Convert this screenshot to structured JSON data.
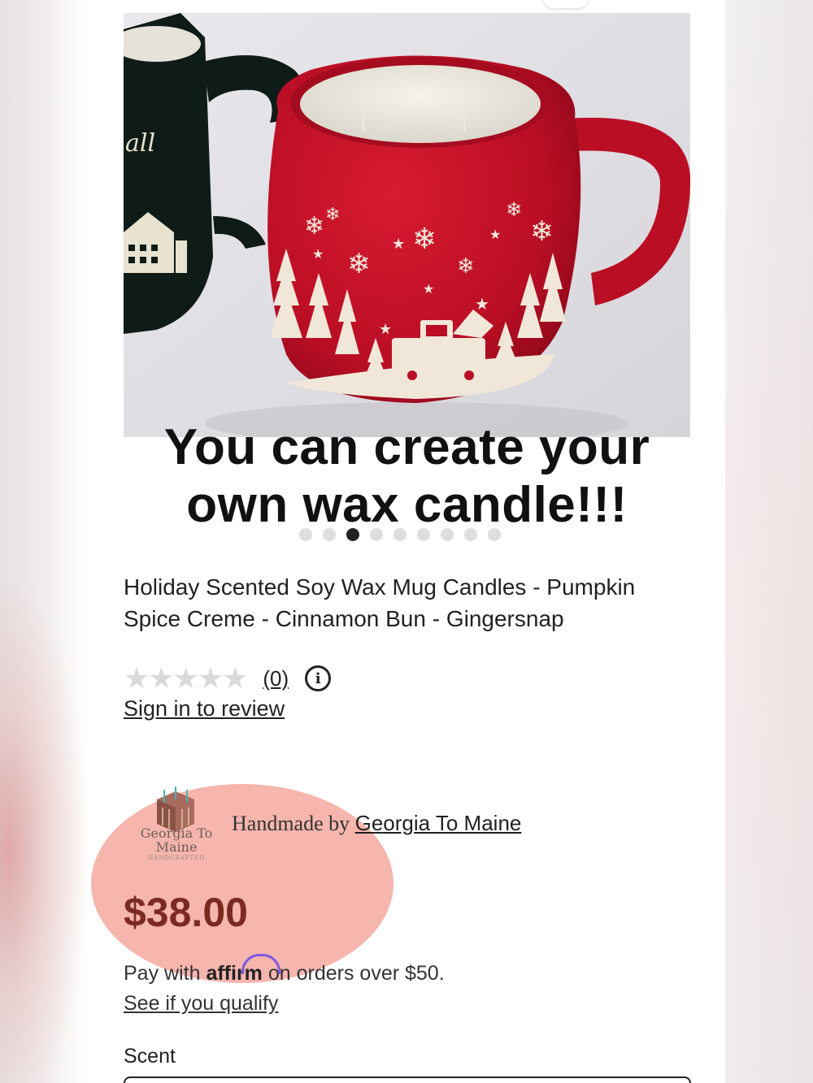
{
  "product": {
    "image_alt": "Red holiday mug candle with white snowflakes, trees and a truck; green mug candle behind it",
    "overlay_text": "You can create your own wax candle!!!",
    "carousel": {
      "total": 9,
      "active_index": 2
    },
    "title": "Holiday Scented Soy Wax Mug Candles - Pumpkin Spice Creme - Cinnamon Bun - Gingersnap"
  },
  "rating": {
    "stars": "★★★★★",
    "value": 0,
    "count_label": "(0)",
    "info_icon": "i",
    "sign_in_label": "Sign in to review"
  },
  "shop": {
    "logo_name": "Georgia To Maine",
    "logo_tagline": "HANDCRAFTED",
    "handmade_prefix": "Handmade by ",
    "shop_name": "Georgia To Maine"
  },
  "pricing": {
    "price": "$38.00",
    "pay_prefix": "Pay with ",
    "affirm_brand": "affirm",
    "pay_suffix": " on orders over $50.",
    "qualify_label": "See if you qualify"
  },
  "options": {
    "scent_label": "Scent"
  },
  "colors": {
    "price": "#7b2a22",
    "highlight": "#f08072",
    "mug_red": "#c8102e",
    "affirm": "#7e58e3"
  }
}
